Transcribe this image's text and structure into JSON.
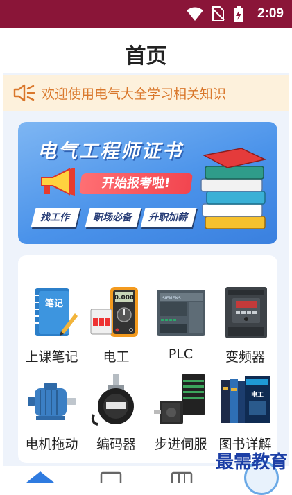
{
  "status_bar": {
    "time": "2:09"
  },
  "header": {
    "title": "首页"
  },
  "notice": {
    "text": "欢迎使用电气大全学习相关知识"
  },
  "banner": {
    "title": "电气工程师证书",
    "cta": "开始报考啦!",
    "tags": [
      "找工作",
      "职场必备",
      "升职加薪"
    ]
  },
  "grid": {
    "items": [
      {
        "label": "上课笔记",
        "icon": "notebook-icon"
      },
      {
        "label": "电工",
        "icon": "multimeter-icon"
      },
      {
        "label": "PLC",
        "icon": "plc-icon"
      },
      {
        "label": "变频器",
        "icon": "inverter-icon"
      },
      {
        "label": "电机拖动",
        "icon": "motor-icon"
      },
      {
        "label": "编码器",
        "icon": "encoder-icon"
      },
      {
        "label": "步进伺服",
        "icon": "stepper-icon"
      },
      {
        "label": "图书详解",
        "icon": "books-icon"
      }
    ],
    "note_book_text": "笔记"
  },
  "watermark": {
    "text": "最需教育"
  },
  "colors": {
    "status_bar": "#8a1538",
    "notice_text": "#d9772b",
    "banner": "#4b93ea",
    "tab_active": "#2f7be0"
  }
}
